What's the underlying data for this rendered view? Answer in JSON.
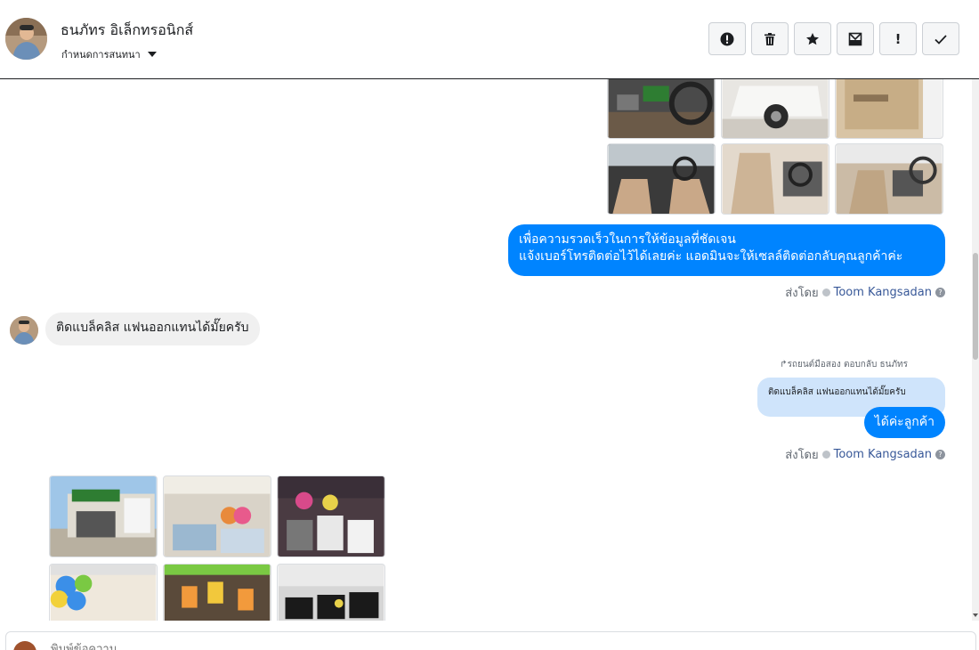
{
  "header": {
    "contact_name": "ธนภัทร อิเล็กทรอนิกส์",
    "assign_label": "กำหนดการสนทนา",
    "actions": [
      {
        "icon": "spam-alert-icon"
      },
      {
        "icon": "trash-icon"
      },
      {
        "icon": "star-icon"
      },
      {
        "icon": "mark-unread-icon"
      },
      {
        "icon": "exclamation-icon",
        "label": "!"
      },
      {
        "icon": "check-icon"
      }
    ]
  },
  "messages": {
    "outgoing_1_line1": "เพื่อความรวดเร็วในการให้ข้อมูลที่ชัดเจน",
    "outgoing_1_line2": "แจ้งเบอร์โทรติดต่อไว้ได้เลยค่ะ แอดมินจะให้เซลล์ติดต่อกลับคุณลูกค้าค่ะ",
    "sent_by_label": "ส่งโดย",
    "agent_name": "Toom Kangsadan",
    "incoming_1": "ติดแบล็คลิส  แฟนออกแทนได้มั๊ยครับ",
    "reply_note": "รถยนต์มือสอง ตอบกลับ ธนภัทร",
    "quoted_text": "ติดแบล็คลิส แฟนออกแทนได้มั๊ยครับ",
    "outgoing_2": "ได้ค่ะลูกค้า",
    "help_glyph": "?"
  },
  "colors": {
    "outgoing_bubble": "#0084ff",
    "incoming_bubble": "#f0f0f0",
    "quote_bubble": "#cfe4fb",
    "agent_link": "#385898"
  },
  "composer": {
    "placeholder": "พิมพ์ข้อความ..."
  }
}
